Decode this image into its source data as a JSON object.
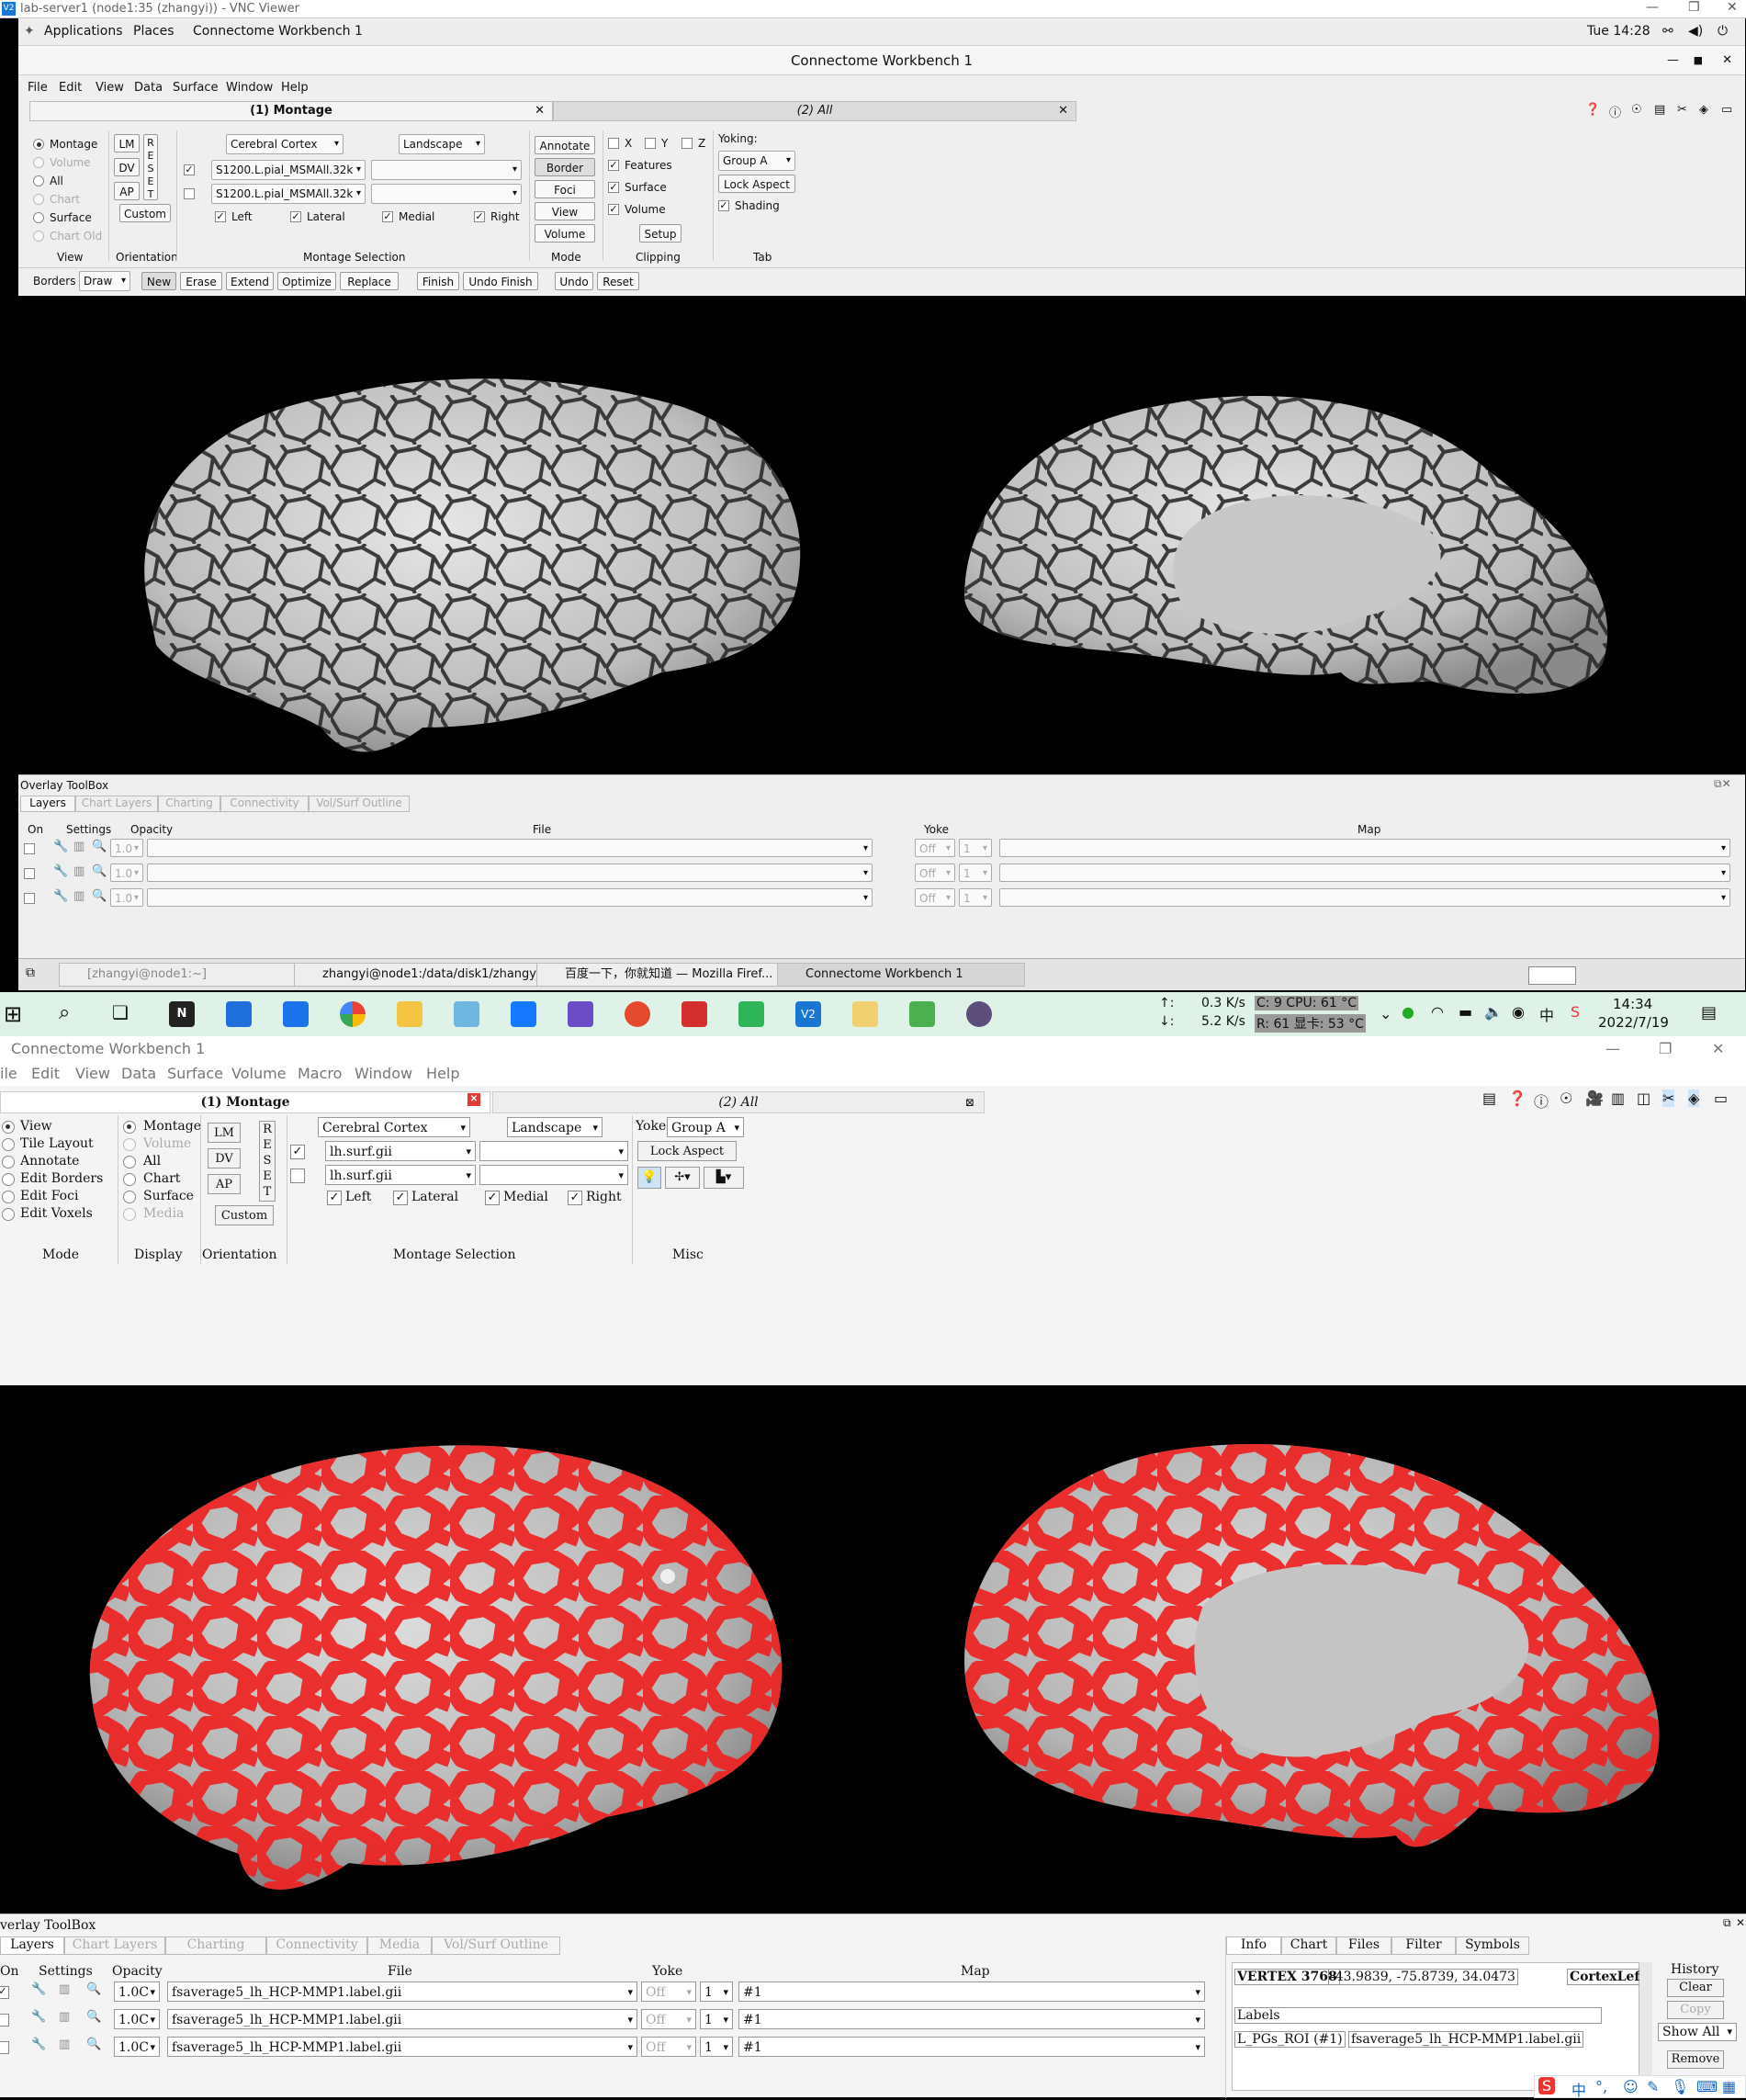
{
  "vnc": {
    "title": "lab-server1 (node1:35 (zhangyi)) - VNC Viewer",
    "logo": "V2"
  },
  "gnome": {
    "applications": "Applications",
    "places": "Places",
    "app": "Connectome Workbench 1",
    "clock": "Tue 14:28"
  },
  "cwb1": {
    "title": "Connectome Workbench 1",
    "menu": [
      "File",
      "Edit",
      "View",
      "Data",
      "Surface",
      "Window",
      "Help"
    ],
    "tab1": "(1) Montage",
    "tab2": "(2) All",
    "view_radios": [
      "Montage",
      "Volume",
      "All",
      "Chart",
      "Surface",
      "Chart Old"
    ],
    "view_label": "View",
    "orient_buttons": [
      "LM",
      "DV",
      "AP"
    ],
    "reset": [
      "R",
      "E",
      "S",
      "E",
      "T"
    ],
    "custom": "Custom",
    "orient_label": "Orientation",
    "structure": "Cerebral Cortex",
    "layout": "Landscape",
    "surface1": "S1200.L.pial_MSMAll.32k",
    "surface2": "S1200.L.pial_MSMAll.32k",
    "sides": [
      "Left",
      "Lateral",
      "Medial",
      "Right"
    ],
    "montage_label": "Montage Selection",
    "mode_buttons": [
      "Annotate",
      "Border",
      "Foci",
      "View",
      "Volume"
    ],
    "mode_label": "Mode",
    "clip_axes": [
      "X",
      "Y",
      "Z"
    ],
    "clip_items": [
      "Features",
      "Surface",
      "Volume"
    ],
    "setup": "Setup",
    "clip_label": "Clipping",
    "yoking": "Yoking:",
    "group": "Group A",
    "lock_aspect": "Lock Aspect",
    "shading": "Shading",
    "tab_label": "Tab",
    "borders": {
      "label": "Borders",
      "draw": "Draw",
      "buttons": [
        "New",
        "Erase",
        "Extend",
        "Optimize",
        "Replace",
        "Finish",
        "Undo Finish",
        "Undo",
        "Reset"
      ]
    }
  },
  "overlay1": {
    "title": "Overlay ToolBox",
    "tabs": [
      "Layers",
      "Chart Layers",
      "Charting",
      "Connectivity",
      "Vol/Surf Outline"
    ],
    "headers": [
      "On",
      "Settings",
      "Opacity",
      "File",
      "Yoke",
      "Map"
    ],
    "opacity": "1.0",
    "yoke": "Off",
    "idx": "1"
  },
  "taskbar1": {
    "items": [
      "[zhangyi@node1:~]",
      "zhangyi@node1:/data/disk1/zhangyi",
      "百度一下，你就知道 — Mozilla Firef...",
      "Connectome Workbench 1"
    ]
  },
  "wintb": {
    "net_up": "0.3 K/s",
    "net_down": "5.2 K/s",
    "cpu": "C:  9 CPU: 61 °C",
    "gpu": "R: 61 显卡: 53 °C",
    "time": "14:34",
    "date": "2022/7/19",
    "up_arrow": "↑:",
    "down_arrow": "↓:"
  },
  "cwb2": {
    "title": "Connectome Workbench 1",
    "menu": [
      "ile",
      "Edit",
      "View",
      "Data",
      "Surface",
      "Volume",
      "Macro",
      "Window",
      "Help"
    ],
    "tab1": "(1) Montage",
    "tab2": "(2) All",
    "mode_radios": [
      "View",
      "Tile Layout",
      "Annotate",
      "Edit Borders",
      "Edit Foci",
      "Edit Voxels"
    ],
    "mode_label": "Mode",
    "display_radios": [
      "Montage",
      "Volume",
      "All",
      "Chart",
      "Surface",
      "Media"
    ],
    "display_label": "Display",
    "orient_buttons": [
      "LM",
      "DV",
      "AP"
    ],
    "reset": [
      "R",
      "E",
      "S",
      "E",
      "T"
    ],
    "custom": "Custom",
    "orient_label": "Orientation",
    "structure": "Cerebral Cortex",
    "layout": "Landscape",
    "surface1": "lh.surf.gii",
    "surface2": "lh.surf.gii",
    "sides": [
      "Left",
      "Lateral",
      "Medial",
      "Right"
    ],
    "montage_label": "Montage Selection",
    "yoke": "Yoke",
    "group": "Group A",
    "lock_aspect": "Lock Aspect",
    "misc_label": "Misc"
  },
  "overlay2": {
    "title": "verlay ToolBox",
    "tabs": [
      "Layers",
      "Chart Layers",
      "Charting",
      "Connectivity",
      "Media",
      "Vol/Surf Outline"
    ],
    "headers": [
      "On",
      "Settings",
      "Opacity",
      "File",
      "Yoke",
      "Map"
    ],
    "rows": [
      {
        "opacity": "1.0C",
        "file": "fsaverage5_lh_HCP-MMP1.label.gii",
        "yoke": "Off",
        "idx": "1",
        "map": "#1"
      },
      {
        "opacity": "1.0C",
        "file": "fsaverage5_lh_HCP-MMP1.label.gii",
        "yoke": "Off",
        "idx": "1",
        "map": "#1"
      },
      {
        "opacity": "1.0C",
        "file": "fsaverage5_lh_HCP-MMP1.label.gii",
        "yoke": "Off",
        "idx": "1",
        "map": "#1"
      }
    ]
  },
  "info": {
    "tabs": [
      "Info",
      "Chart",
      "Files",
      "Filter",
      "Symbols"
    ],
    "vertex": "VERTEX 3768",
    "coords": "-43.9839, -75.8739, 34.0473",
    "cortex": "CortexLef",
    "labels": "Labels",
    "roi": "L_PGs_ROI (#1)",
    "roi_file": "fsaverage5_lh_HCP-MMP1.label.gii",
    "history": "History",
    "clear": "Clear",
    "copy": "Copy",
    "show_all": "Show All",
    "remove": "Remove"
  },
  "ime": {
    "lang": "中",
    "punct": "°,"
  }
}
